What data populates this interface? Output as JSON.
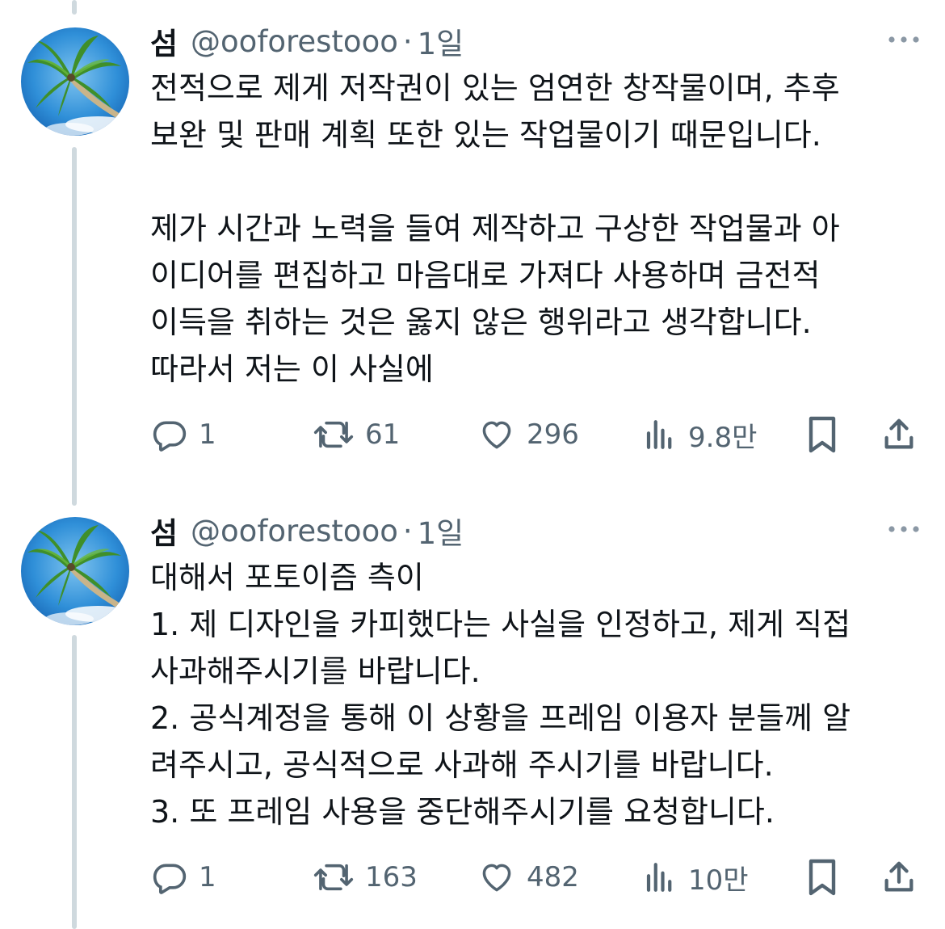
{
  "tweets": [
    {
      "name": "섬",
      "handle": "@ooforestooo",
      "dot": "·",
      "time": "1일",
      "lines": [
        "전적으로 제게 저작권이 있는 엄연한 창작물이며, 추후",
        "보완 및 판매 계획 또한 있는 작업물이기 때문입니다.",
        "",
        "제가 시간과 노력을 들여 제작하고 구상한 작업물과 아",
        "이디어를 편집하고 마음대로 가져다 사용하며 금전적",
        "이득을 취하는 것은 옳지 않은 행위라고 생각합니다.",
        "따라서 저는 이 사실에"
      ],
      "replies": "1",
      "retweets": "61",
      "likes": "296",
      "views": "9.8만"
    },
    {
      "name": "섬",
      "handle": "@ooforestooo",
      "dot": "·",
      "time": "1일",
      "lines": [
        "대해서 포토이즘 측이",
        "1. 제 디자인을 카피했다는 사실을 인정하고, 제게 직접",
        "사과해주시기를 바랍니다.",
        "2. 공식계정을 통해 이 상황을 프레임 이용자 분들께 알",
        "려주시고, 공식적으로 사과해 주시기를 바랍니다.",
        "3. 또 프레임 사용을 중단해주시기를 요청합니다."
      ],
      "replies": "1",
      "retweets": "163",
      "likes": "482",
      "views": "10만"
    }
  ],
  "icons": {
    "more": "more-dots-icon",
    "reply": "reply-icon",
    "retweet": "retweet-icon",
    "like": "heart-icon",
    "views": "views-chart-icon",
    "bookmark": "bookmark-icon",
    "share": "share-icon"
  },
  "colors": {
    "text": "#0f1419",
    "secondary": "#536471",
    "thread_line": "#cfd9de"
  }
}
